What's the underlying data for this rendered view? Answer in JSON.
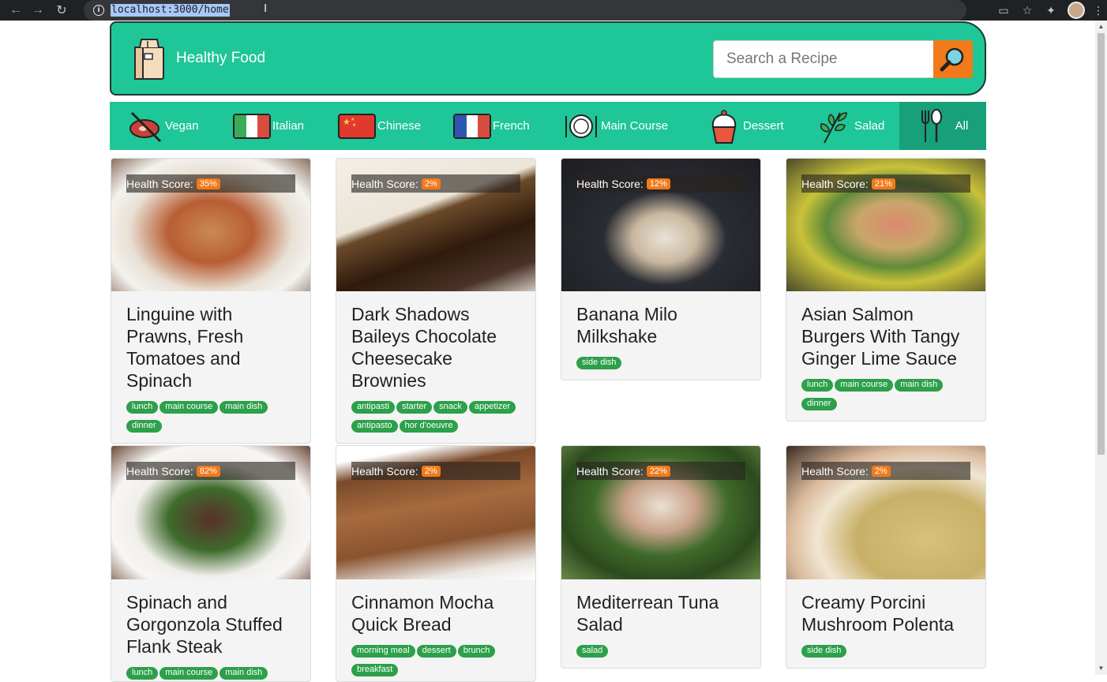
{
  "browser": {
    "url": "localhost:3000/home"
  },
  "header": {
    "title": "Healthy Food",
    "search_placeholder": "Search a Recipe"
  },
  "categories": [
    {
      "label": "Vegan",
      "icon": "vegan-icon"
    },
    {
      "label": "Italian",
      "icon": "italy-flag-icon"
    },
    {
      "label": "Chinese",
      "icon": "china-flag-icon"
    },
    {
      "label": "French",
      "icon": "france-flag-icon"
    },
    {
      "label": "Main Course",
      "icon": "plate-cutlery-icon"
    },
    {
      "label": "Dessert",
      "icon": "cupcake-icon"
    },
    {
      "label": "Salad",
      "icon": "herb-icon"
    },
    {
      "label": "All",
      "icon": "fork-spoon-icon"
    }
  ],
  "score_label": "Health Score:",
  "recipes": [
    {
      "title": "Linguine with Prawns, Fresh Tomatoes and Spinach",
      "score": "35%",
      "tags": [
        "lunch",
        "main course",
        "main dish",
        "dinner"
      ],
      "image": "prawn-linguine"
    },
    {
      "title": "Dark Shadows Baileys Chocolate Cheesecake Brownies",
      "score": "2%",
      "tags": [
        "antipasti",
        "starter",
        "snack",
        "appetizer",
        "antipasto",
        "hor d'oeuvre"
      ],
      "image": "cheesecake-brownie"
    },
    {
      "title": "Banana Milo Milkshake",
      "score": "12%",
      "tags": [
        "side dish"
      ],
      "image": "milkshake"
    },
    {
      "title": "Asian Salmon Burgers With Tangy Ginger Lime Sauce",
      "score": "21%",
      "tags": [
        "lunch",
        "main course",
        "main dish",
        "dinner"
      ],
      "image": "salmon-burger"
    },
    {
      "title": "Spinach and Gorgonzola Stuffed Flank Steak",
      "score": "82%",
      "tags": [
        "lunch",
        "main course",
        "main dish"
      ],
      "image": "flank-steak"
    },
    {
      "title": "Cinnamon Mocha Quick Bread",
      "score": "2%",
      "tags": [
        "morning meal",
        "dessert",
        "brunch",
        "breakfast"
      ],
      "image": "quick-bread"
    },
    {
      "title": "Mediterrean Tuna Salad",
      "score": "22%",
      "tags": [
        "salad"
      ],
      "image": "tuna-salad"
    },
    {
      "title": "Creamy Porcini Mushroom Polenta",
      "score": "2%",
      "tags": [
        "side dish"
      ],
      "image": "polenta"
    }
  ]
}
